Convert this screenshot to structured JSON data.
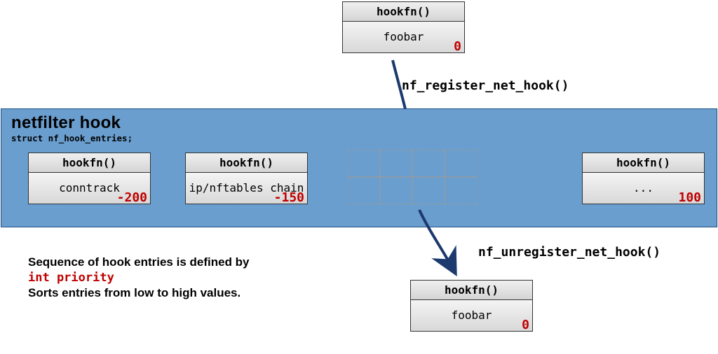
{
  "top_hook": {
    "header": "hookfn()",
    "body": "foobar",
    "priority": "0"
  },
  "register_call": "nf_register_net_hook()",
  "unregister_call": "nf_unregister_net_hook()",
  "container": {
    "title": "netfilter hook",
    "subtitle": "struct nf_hook_entries;"
  },
  "entries": [
    {
      "header": "hookfn()",
      "body": "conntrack",
      "priority": "-200"
    },
    {
      "header": "hookfn()",
      "body": "ip/nftables chain",
      "priority": "-150"
    },
    {
      "header": "hookfn()",
      "body": "...",
      "priority": "100"
    }
  ],
  "bottom_hook": {
    "header": "hookfn()",
    "body": "foobar",
    "priority": "0"
  },
  "note": {
    "line1": "Sequence of hook entries is defined by",
    "line2": "int priority",
    "line3": "Sorts entries from low to high values."
  }
}
